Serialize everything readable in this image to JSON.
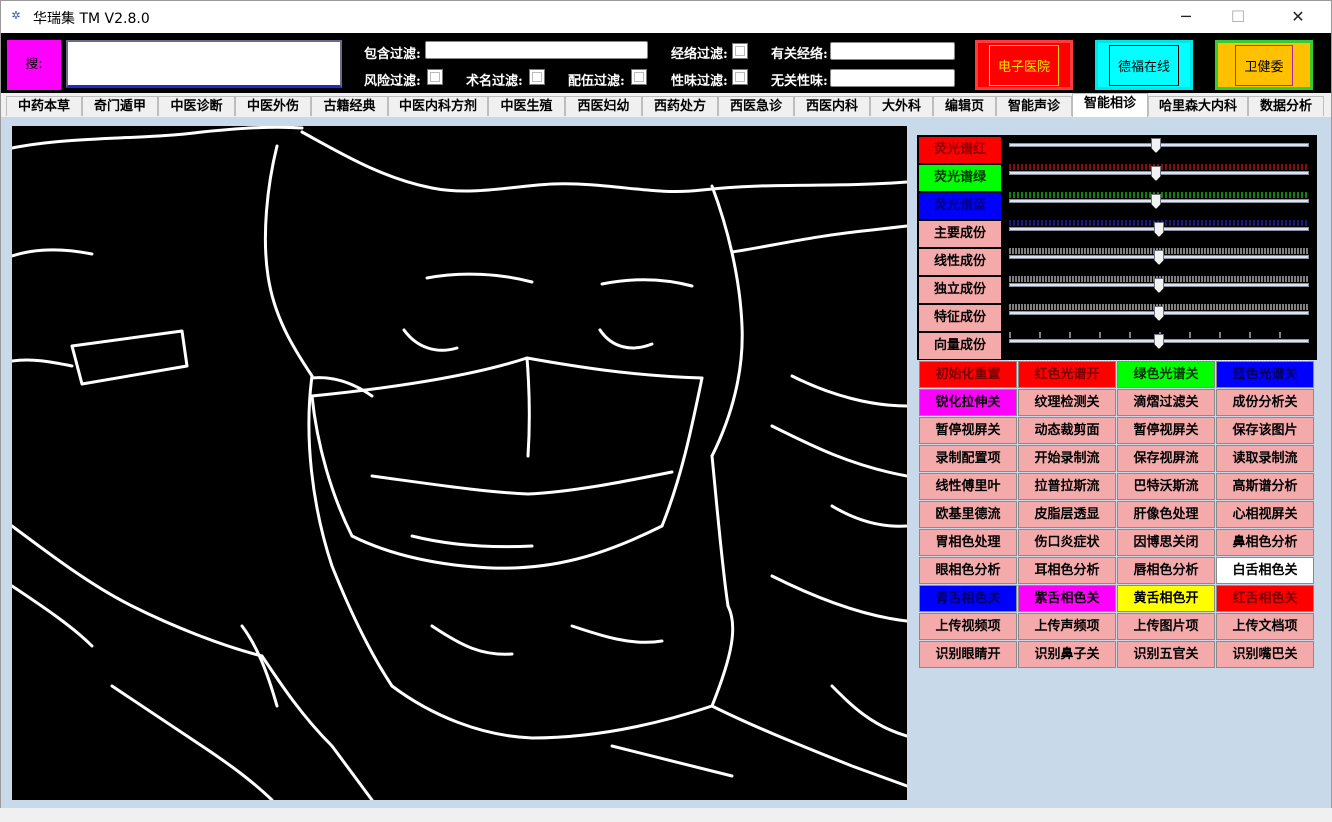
{
  "app": {
    "title": "华瑞集 TM V2.8.0"
  },
  "window_controls": {
    "minimize": "─",
    "maximize": "☐",
    "close": "✕"
  },
  "toolbar": {
    "mag_label": "搜:",
    "main_input_value": "",
    "include_filter_label": "包含过滤:",
    "include_filter_value": "",
    "risk_filter_label": "风险过滤:",
    "surgery_filter_label": "术名过滤:",
    "compat_filter_label": "配伍过滤:",
    "meridian_filter_label": "经络过滤:",
    "nature_filter_label": "性味过滤:",
    "related_meridian_label": "有关经络:",
    "related_meridian_value": "",
    "unrelated_nature_label": "无关性味:",
    "unrelated_nature_value": "",
    "hospital_button": "电子医院",
    "online_button": "德福在线",
    "commission_button": "卫健委"
  },
  "tabs": [
    {
      "label": "中药本草"
    },
    {
      "label": "奇门遁甲"
    },
    {
      "label": "中医诊断"
    },
    {
      "label": "中医外伤"
    },
    {
      "label": "古籍经典"
    },
    {
      "label": "中医内科方剂"
    },
    {
      "label": "中医生殖"
    },
    {
      "label": "西医妇幼"
    },
    {
      "label": "西药处方"
    },
    {
      "label": "西医急诊"
    },
    {
      "label": "西医内科"
    },
    {
      "label": "大外科"
    },
    {
      "label": "编辑页"
    },
    {
      "label": "智能声诊"
    },
    {
      "label": "智能相诊",
      "active": true
    },
    {
      "label": "哈里森大内科"
    },
    {
      "label": "数据分析"
    }
  ],
  "sliders": [
    {
      "label": "荧光谱红",
      "bg": "#ff0000",
      "fg": "#8a0000",
      "value": 0.49,
      "tick_color": "#ff2020"
    },
    {
      "label": "荧光谱绿",
      "bg": "#00ff00",
      "fg": "#003300",
      "value": 0.49,
      "tick_color": "#20ff20"
    },
    {
      "label": "荧光谱蓝",
      "bg": "#0000ff",
      "fg": "#000080",
      "value": 0.49,
      "tick_color": "#3030ff"
    },
    {
      "label": "主要成份",
      "bg": "#f4aaaa",
      "fg": "#000000",
      "value": 0.5,
      "tick_color": "#ffffff"
    },
    {
      "label": "线性成份",
      "bg": "#f4aaaa",
      "fg": "#000000",
      "value": 0.5,
      "tick_color": "#ffffff"
    },
    {
      "label": "独立成份",
      "bg": "#f4aaaa",
      "fg": "#000000",
      "value": 0.5,
      "tick_color": "#ffffff"
    },
    {
      "label": "特征成份",
      "bg": "#f4aaaa",
      "fg": "#000000",
      "value": 0.5,
      "tick_color": "#ffffff"
    },
    {
      "label": "向量成份",
      "bg": "#f4aaaa",
      "fg": "#000000",
      "value": 0.5,
      "tick_color": "#ffffff"
    }
  ],
  "buttons": [
    [
      {
        "label": "初始化重置",
        "bg": "#ff0000",
        "fg": "#7a0000"
      },
      {
        "label": "红色光谱开",
        "bg": "#ff0000",
        "fg": "#7a0000"
      },
      {
        "label": "绿色光谱关",
        "bg": "#00ff00",
        "fg": "#003300"
      },
      {
        "label": "蓝色光谱关",
        "bg": "#0000ff",
        "fg": "#000060"
      }
    ],
    [
      {
        "label": "锐化拉伸关",
        "bg": "#ff00ff",
        "fg": "#000000"
      },
      {
        "label": "纹理检测关",
        "bg": "#f4aaaa",
        "fg": "#000000"
      },
      {
        "label": "滴熠过滤关",
        "bg": "#f4aaaa",
        "fg": "#000000"
      },
      {
        "label": "成份分析关",
        "bg": "#f4aaaa",
        "fg": "#000000"
      }
    ],
    [
      {
        "label": "暂停视屏关",
        "bg": "#f4aaaa",
        "fg": "#000000"
      },
      {
        "label": "动态裁剪面",
        "bg": "#f4aaaa",
        "fg": "#000000"
      },
      {
        "label": "暂停视屏关",
        "bg": "#f4aaaa",
        "fg": "#000000"
      },
      {
        "label": "保存该图片",
        "bg": "#f4aaaa",
        "fg": "#000000"
      }
    ],
    [
      {
        "label": "录制配置项",
        "bg": "#f4aaaa",
        "fg": "#000000"
      },
      {
        "label": "开始录制流",
        "bg": "#f4aaaa",
        "fg": "#000000"
      },
      {
        "label": "保存视屏流",
        "bg": "#f4aaaa",
        "fg": "#000000"
      },
      {
        "label": "读取录制流",
        "bg": "#f4aaaa",
        "fg": "#000000"
      }
    ],
    [
      {
        "label": "线性傅里叶",
        "bg": "#f4aaaa",
        "fg": "#000000"
      },
      {
        "label": "拉普拉斯流",
        "bg": "#f4aaaa",
        "fg": "#000000"
      },
      {
        "label": "巴特沃斯流",
        "bg": "#f4aaaa",
        "fg": "#000000"
      },
      {
        "label": "高斯谱分析",
        "bg": "#f4aaaa",
        "fg": "#000000"
      }
    ],
    [
      {
        "label": "欧基里德流",
        "bg": "#f4aaaa",
        "fg": "#000000"
      },
      {
        "label": "皮脂层透显",
        "bg": "#f4aaaa",
        "fg": "#000000"
      },
      {
        "label": "肝像色处理",
        "bg": "#f4aaaa",
        "fg": "#000000"
      },
      {
        "label": "心相视屏关",
        "bg": "#f4aaaa",
        "fg": "#000000"
      }
    ],
    [
      {
        "label": "胃相色处理",
        "bg": "#f4aaaa",
        "fg": "#000000"
      },
      {
        "label": "伤口炎症状",
        "bg": "#f4aaaa",
        "fg": "#000000"
      },
      {
        "label": "因博思关闭",
        "bg": "#f4aaaa",
        "fg": "#000000"
      },
      {
        "label": "鼻相色分析",
        "bg": "#f4aaaa",
        "fg": "#000000"
      }
    ],
    [
      {
        "label": "眼相色分析",
        "bg": "#f4aaaa",
        "fg": "#000000"
      },
      {
        "label": "耳相色分析",
        "bg": "#f4aaaa",
        "fg": "#000000"
      },
      {
        "label": "唇相色分析",
        "bg": "#f4aaaa",
        "fg": "#000000"
      },
      {
        "label": "白舌相色关",
        "bg": "#ffffff",
        "fg": "#000000"
      }
    ],
    [
      {
        "label": "青舌相色关",
        "bg": "#0000ff",
        "fg": "#000060"
      },
      {
        "label": "紫舌相色关",
        "bg": "#ff00ff",
        "fg": "#000000"
      },
      {
        "label": "黄舌相色开",
        "bg": "#ffff00",
        "fg": "#000000"
      },
      {
        "label": "红舌相色关",
        "bg": "#ff0000",
        "fg": "#7a0000"
      }
    ],
    [
      {
        "label": "上传视频项",
        "bg": "#f4aaaa",
        "fg": "#000000"
      },
      {
        "label": "上传声频项",
        "bg": "#f4aaaa",
        "fg": "#000000"
      },
      {
        "label": "上传图片项",
        "bg": "#f4aaaa",
        "fg": "#000000"
      },
      {
        "label": "上传文档项",
        "bg": "#f4aaaa",
        "fg": "#000000"
      }
    ],
    [
      {
        "label": "识别眼睛开",
        "bg": "#f4aaaa",
        "fg": "#000000"
      },
      {
        "label": "识别鼻子关",
        "bg": "#f4aaaa",
        "fg": "#000000"
      },
      {
        "label": "识别五官关",
        "bg": "#f4aaaa",
        "fg": "#000000"
      },
      {
        "label": "识别嘴巴关",
        "bg": "#f4aaaa",
        "fg": "#000000"
      }
    ]
  ],
  "colors": {
    "content_bg": "#c8d9ea",
    "video_bg": "#000000",
    "edge_stroke": "#ffffff"
  }
}
